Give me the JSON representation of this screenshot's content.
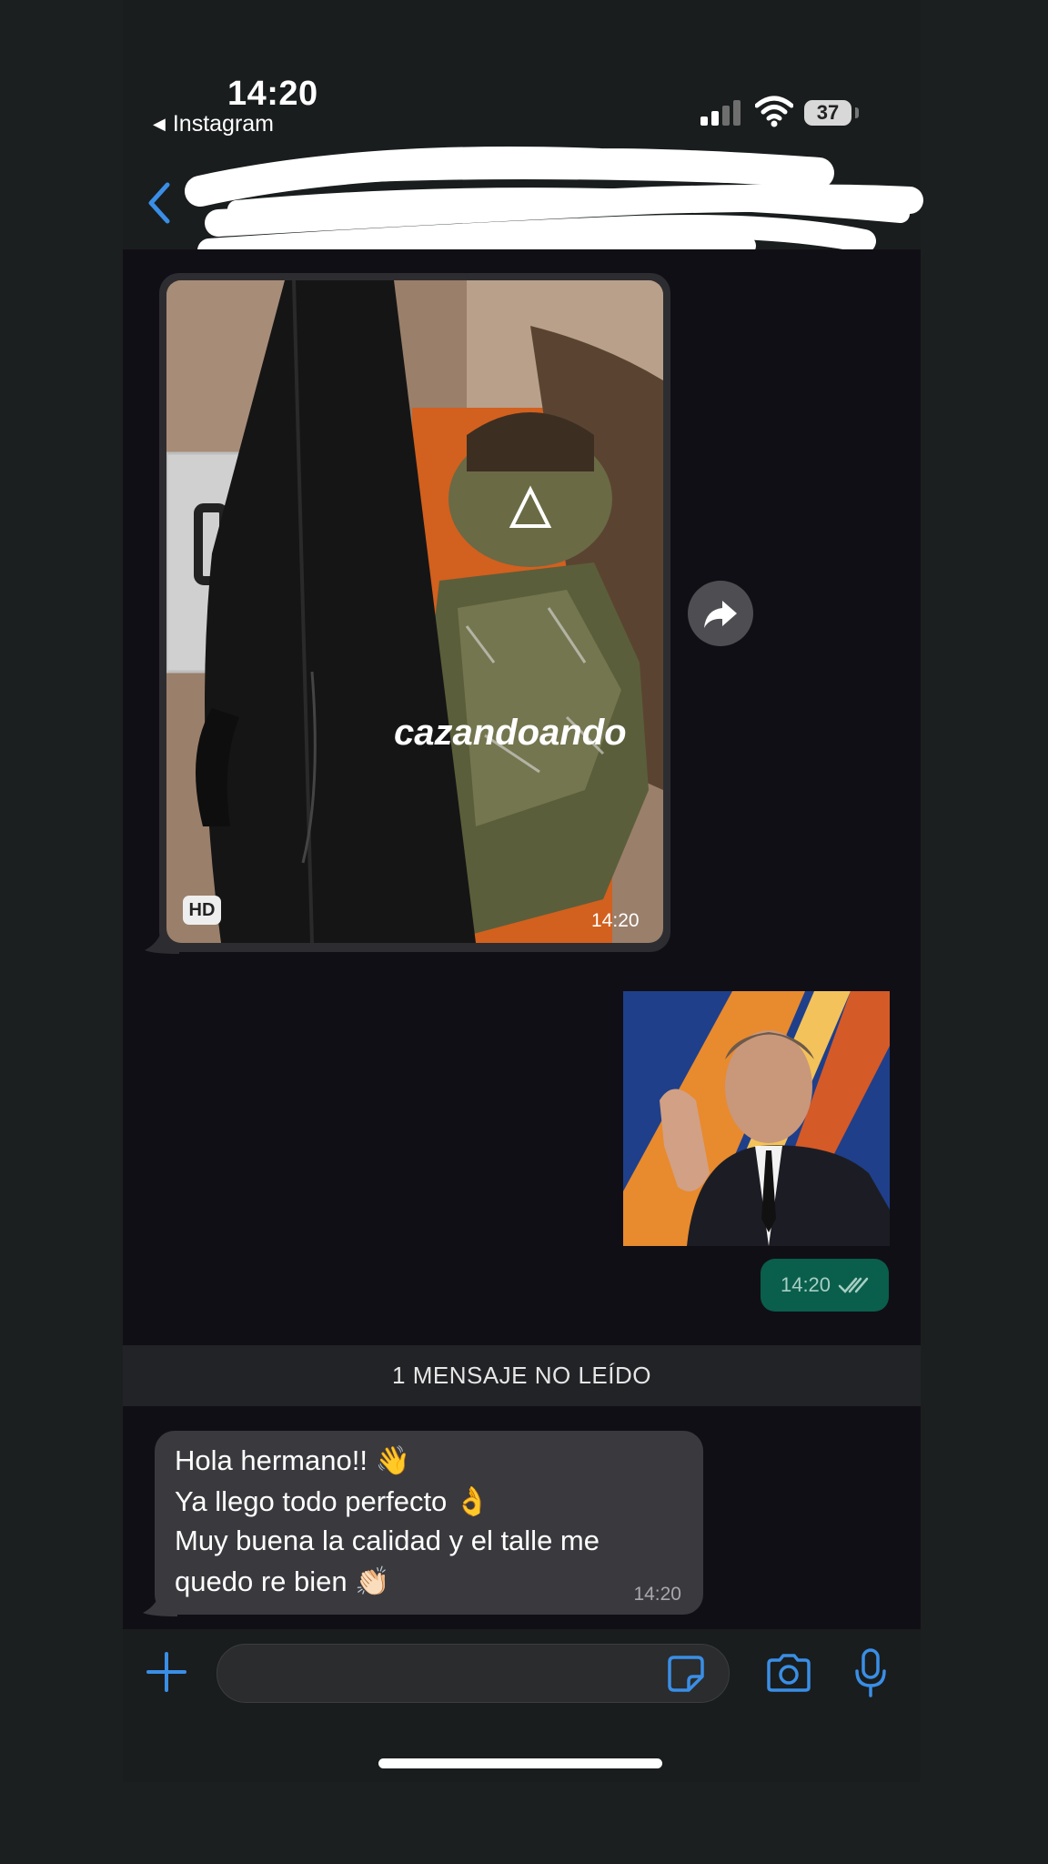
{
  "status_bar": {
    "time": "14:20",
    "back_app": "Instagram",
    "battery": "37"
  },
  "header": {
    "contact_name": ""
  },
  "messages": {
    "image_message": {
      "badge": "HD",
      "time": "14:20",
      "image_caption_text": "cazandoando"
    },
    "sticker_message": {
      "time": "14:20"
    },
    "unread_divider": "1 MENSAJE NO LEÍDO",
    "text_message": {
      "lines": [
        "Hola hermano!! 👋",
        "Ya llego todo perfecto 👌",
        "Muy buena la calidad y el talle me",
        "quedo re bien 👏🏻"
      ],
      "time": "14:20"
    }
  },
  "colors": {
    "accent": "#3a8ee6",
    "sent_bubble": "#0a5e4c",
    "received_bubble": "#3a393e",
    "chat_background": "#110f16"
  },
  "icons": {
    "back": "chevron-left-icon",
    "forward": "forward-arrow-icon",
    "plus": "plus-icon",
    "sticker": "sticker-icon",
    "camera": "camera-icon",
    "mic": "microphone-icon",
    "read_receipt": "double-check-icon"
  }
}
